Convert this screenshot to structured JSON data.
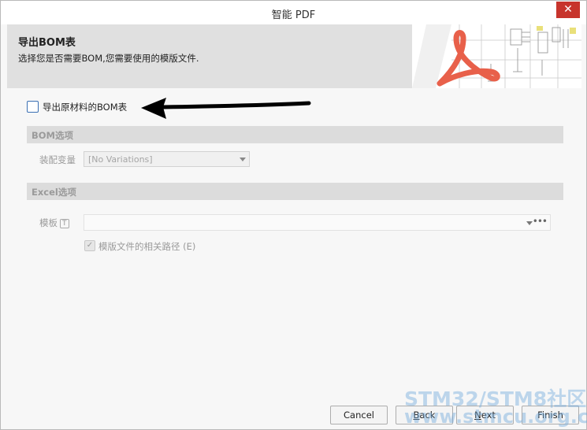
{
  "window": {
    "title": "智能 PDF",
    "close_glyph": "✕"
  },
  "header": {
    "title": "导出BOM表",
    "subtitle": "选择您是否需要BOM,您需要使用的模版文件."
  },
  "export_bom": {
    "label": "导出原材料的BOM表",
    "checked": false
  },
  "bom_options": {
    "section_title": "BOM选项",
    "variant_label": "装配变量",
    "variant_value": "[No Variations]"
  },
  "excel_options": {
    "section_title": "Excel选项",
    "template_label": "模板",
    "template_info": "T",
    "template_value": "",
    "browse_glyph": "•••",
    "relative_path_label": "模版文件的相关路径",
    "relative_path_shortcut": "(E)",
    "relative_path_checked": true
  },
  "buttons": {
    "cancel": "Cancel",
    "back_prefix": "",
    "back_mnemonic": "B",
    "back_suffix": "ack",
    "next_prefix": "",
    "next_mnemonic": "N",
    "next_suffix": "ext",
    "finish": "Finish"
  },
  "watermark": {
    "line1": "STM32/STM8社区",
    "line2": "www.stmcu.org.cn"
  },
  "colors": {
    "close_button": "#c7342c",
    "header_bg": "#e0e0e0",
    "section_bg": "#dcdcdc",
    "pdf_logo": "#e8604a",
    "checkbox_border": "#3a6fb3"
  }
}
